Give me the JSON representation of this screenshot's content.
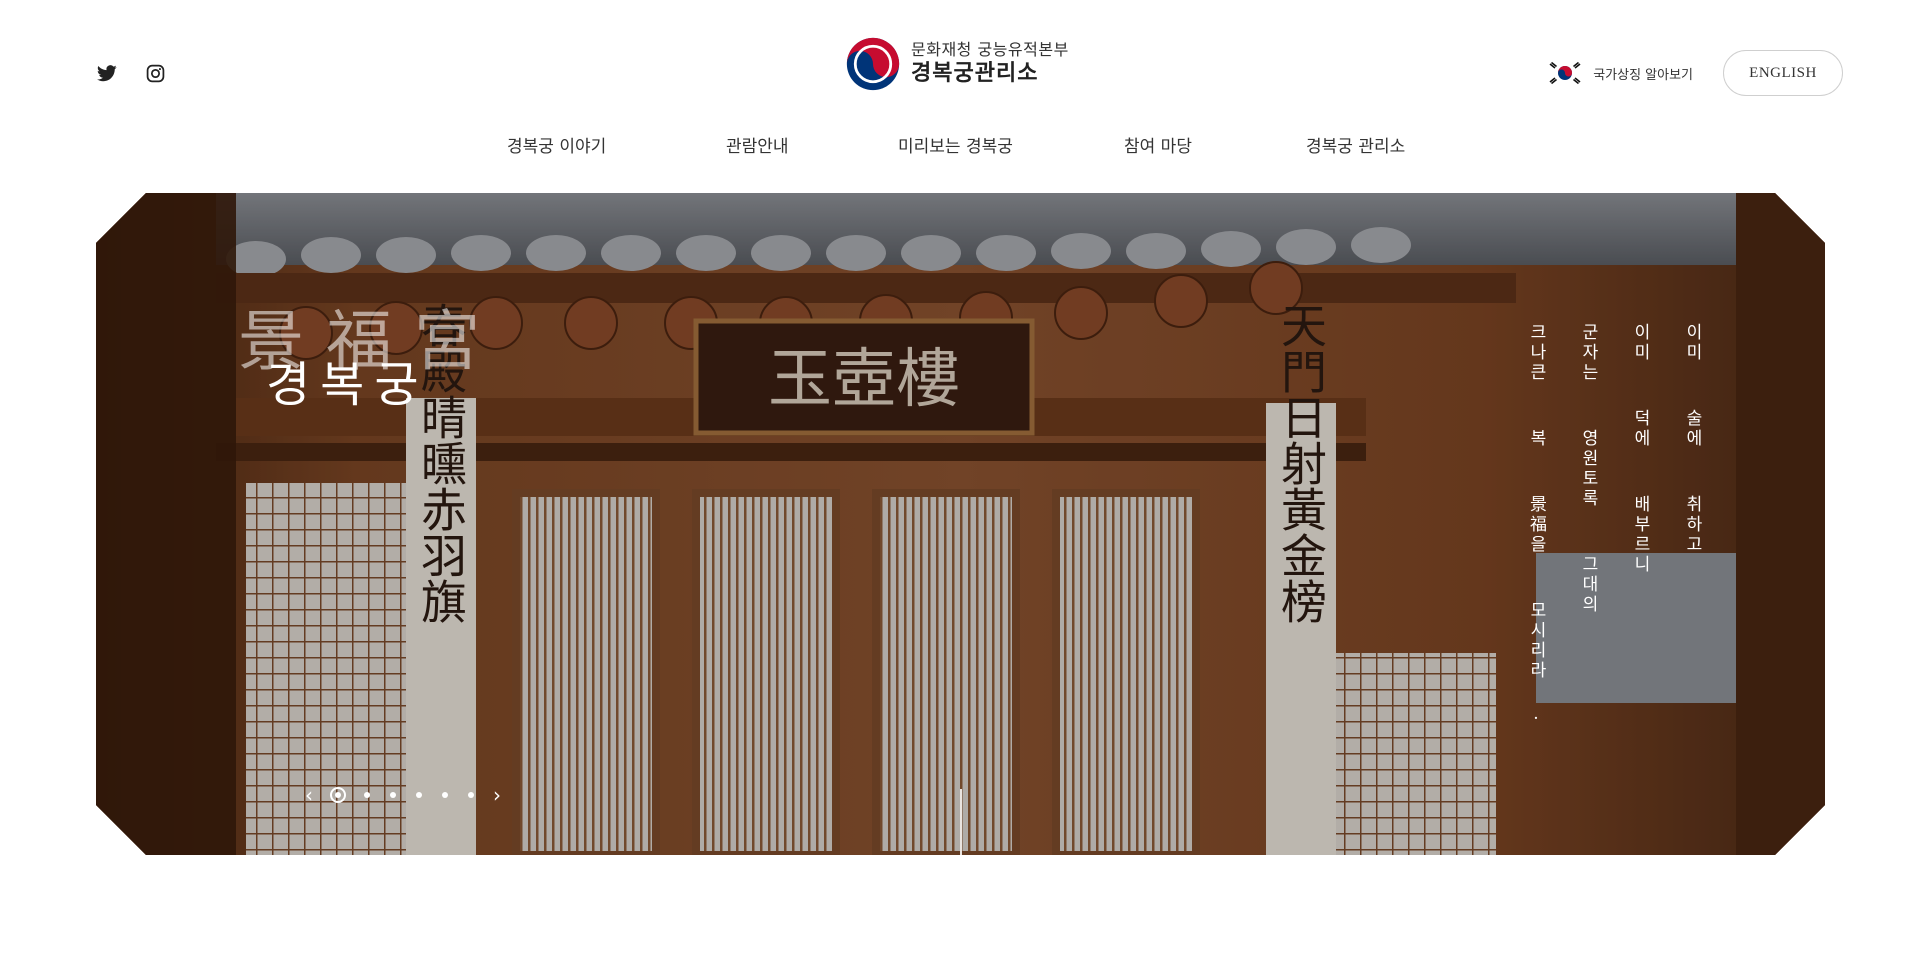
{
  "header": {
    "social": [
      {
        "name": "twitter-icon"
      },
      {
        "name": "instagram-icon"
      }
    ],
    "logo": {
      "sub": "문화재청 궁능유적본부",
      "main": "경복궁관리소"
    },
    "symbol_link": "국가상징 알아보기",
    "english_label": "ENGLISH"
  },
  "gnb": {
    "items": [
      "경복궁 이야기",
      "관람안내",
      "미리보는 경복궁",
      "참여 마당",
      "경복궁 관리소"
    ]
  },
  "hero": {
    "hanja_title": "景福宮",
    "kr_title": "경복궁",
    "poem": [
      "이미  술에  취하고",
      "이미  덕에  배부르니",
      "군자는  영원토록  그대의",
      "크나큰  복  景福을  모시리라 ."
    ],
    "board_text": "玉壺樓",
    "left_pillar_text": "春殿晴曛赤羽旗",
    "right_pillar_text": "天門日射黃金榜",
    "slider": {
      "prev": "‹",
      "next": "›",
      "total": 6,
      "active": 0
    }
  },
  "colors": {
    "text": "#333333",
    "taegeuk_red": "#c60c30",
    "taegeuk_blue": "#003478",
    "wood": "#7a4522"
  }
}
